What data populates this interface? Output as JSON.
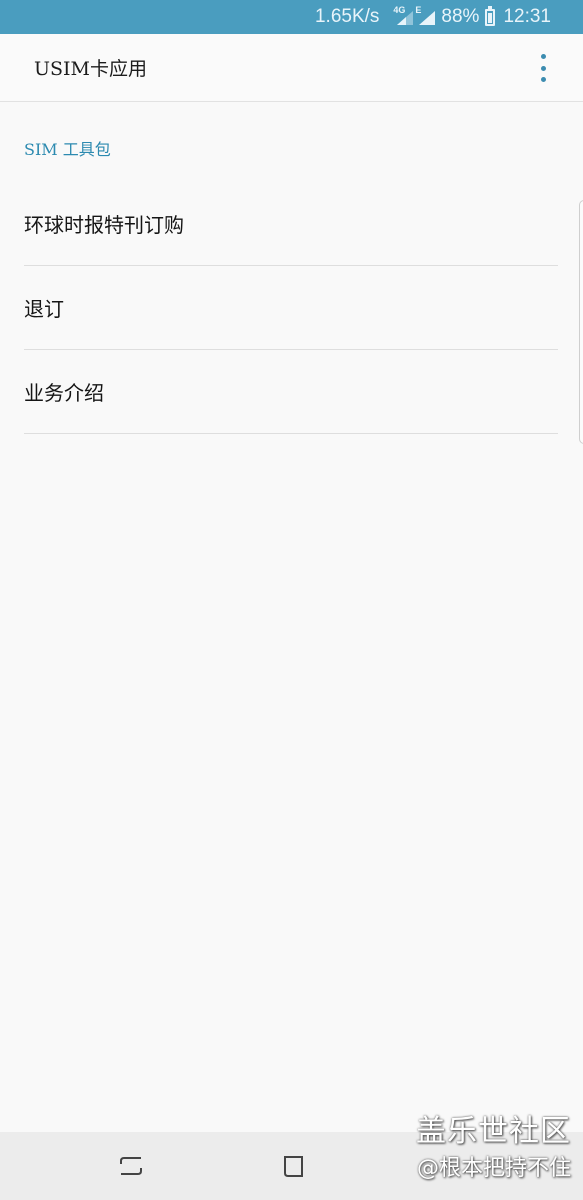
{
  "status_bar": {
    "speed": "1.65K/s",
    "sim1_network": "4G",
    "sim2_network": "E",
    "battery_percent": "88%",
    "time": "12:31"
  },
  "app_bar": {
    "title": "USIM卡应用",
    "menu_icon": "more-vert-icon"
  },
  "section": {
    "header": "SIM 工具包"
  },
  "items": [
    {
      "label": "环球时报特刊订购"
    },
    {
      "label": "退订"
    },
    {
      "label": "业务介绍"
    }
  ],
  "nav_bar": {
    "recents_icon": "recent-apps-icon",
    "home_icon": "home-icon"
  },
  "watermark": {
    "line1": "盖乐世社区",
    "line2": "@根本把持不住"
  },
  "colors": {
    "status_bar_bg": "#4a9dbf",
    "accent": "#2c8ab0",
    "background": "#f9f9f9"
  }
}
